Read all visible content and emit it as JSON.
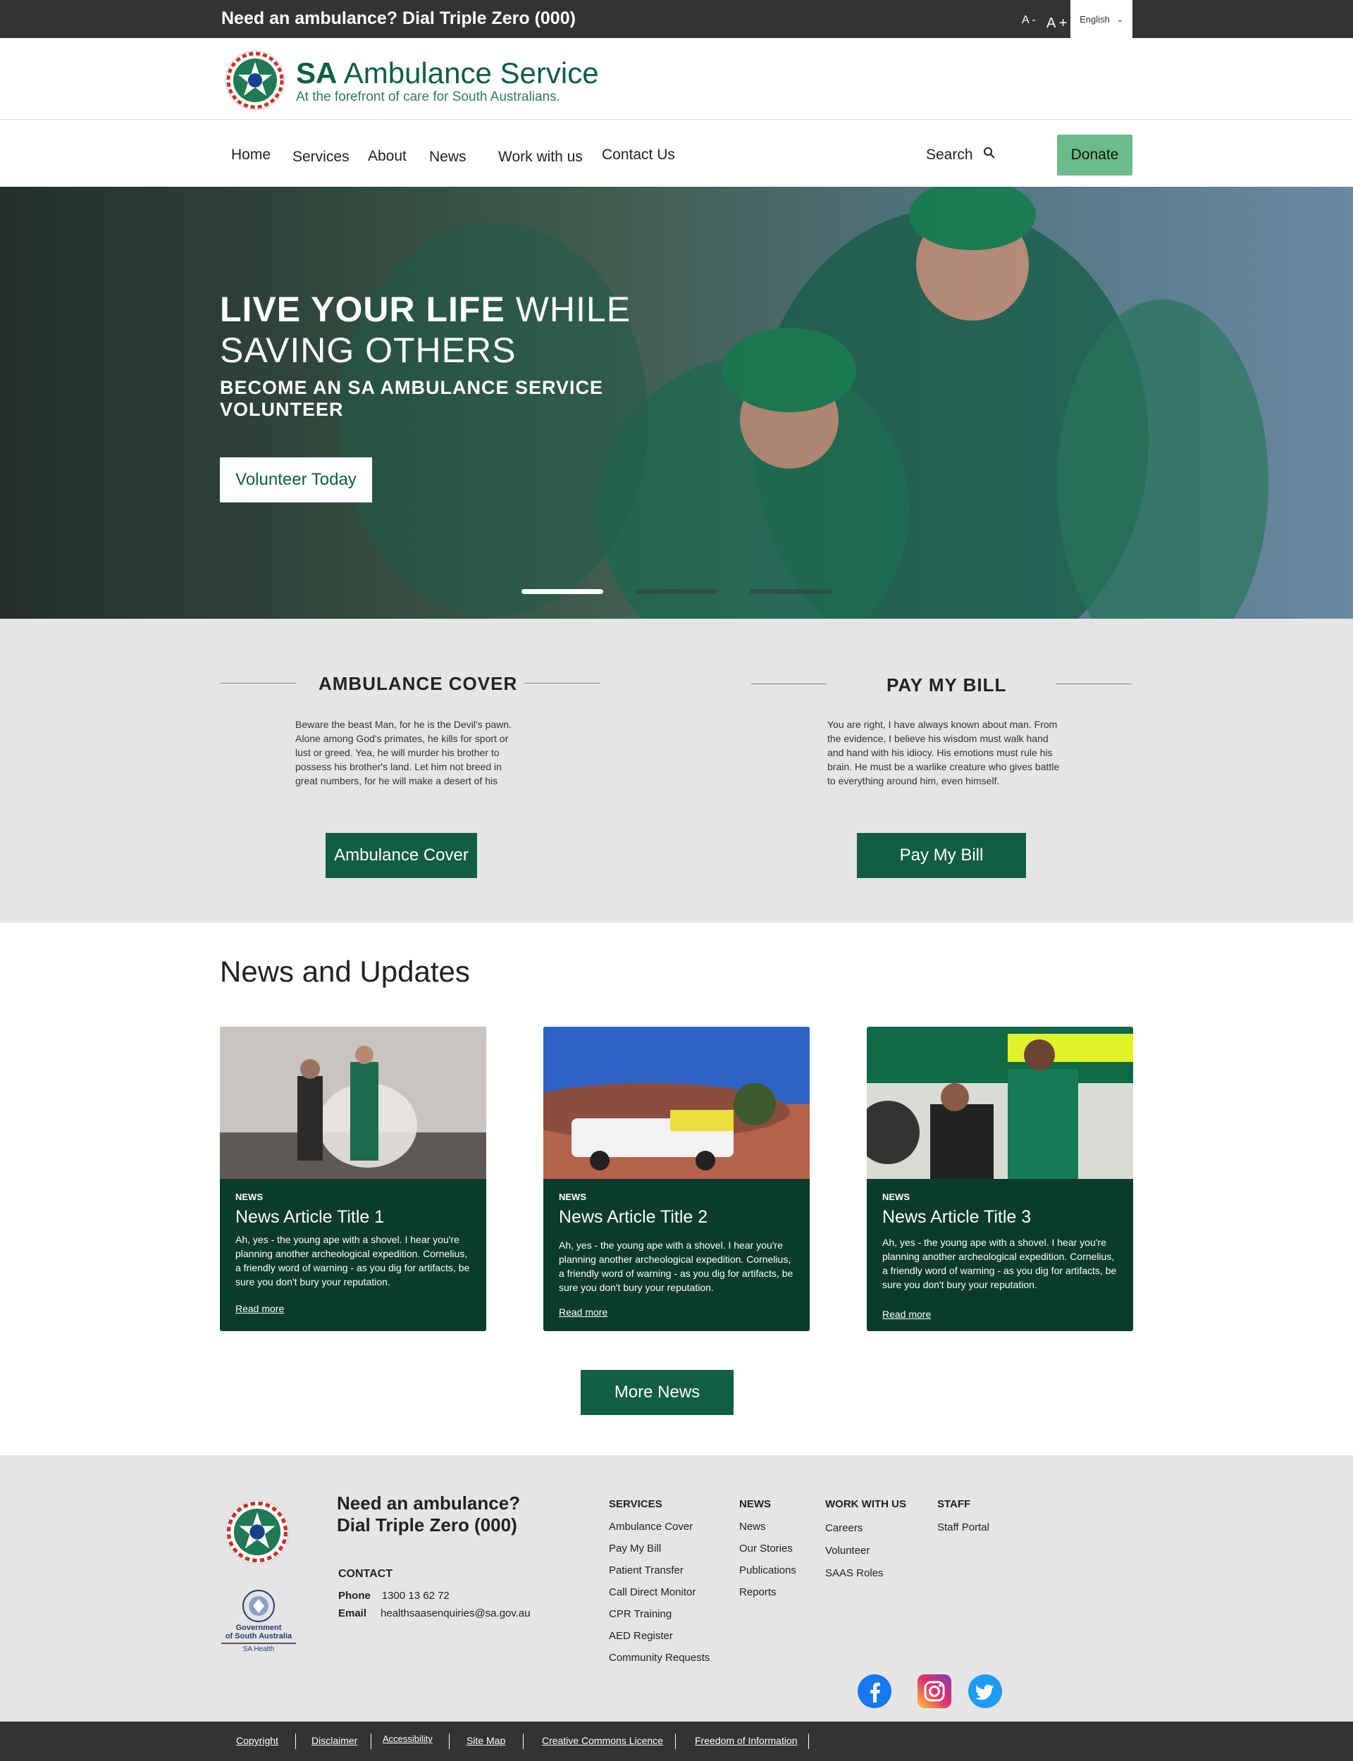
{
  "topbar": {
    "emergency": "Need an ambulance? Dial Triple Zero (000)",
    "font_decrease": "A -",
    "font_increase": "A +",
    "language": "English"
  },
  "brand": {
    "name_bold": "SA",
    "name_rest": " Ambulance Service",
    "tagline": "At the forefront of care for South Australians."
  },
  "nav": {
    "items": [
      "Home",
      "Services",
      "About",
      "News",
      "Work with us",
      "Contact Us"
    ],
    "search_label": "Search",
    "donate_label": "Donate"
  },
  "hero": {
    "headline_bold": "LIVE YOUR LIFE",
    "headline_rest": " WHILE",
    "headline_line2": "SAVING OTHERS",
    "subheadline": "BECOME AN SA AMBULANCE SERVICE VOLUNTEER",
    "cta": "Volunteer Today",
    "active_slide": 1,
    "slide_count": 3
  },
  "cover": {
    "title": "AMBULANCE COVER",
    "text": "Beware the beast Man, for he is the Devil's pawn. Alone among God's primates, he kills for sport or lust or greed. Yea, he will murder his brother to possess his brother's land. Let him not breed in great numbers, for he will make a desert of his",
    "button": "Ambulance Cover"
  },
  "bill": {
    "title": "PAY MY BILL",
    "text": "You are right, I have always known about man. From the evidence, I believe his wisdom must walk hand and hand with his idiocy. His emotions must rule his brain. He must be a warlike creature who gives battle to everything around him, even himself.",
    "button": "Pay My Bill"
  },
  "news": {
    "title": "News and Updates",
    "cards": [
      {
        "tag": "NEWS",
        "title": "News Article Title 1",
        "desc": "Ah, yes - the young ape with a shovel. I hear you're planning another archeological expedition. Cornelius, a friendly word of warning - as you dig for artifacts, be sure you don't bury your reputation.",
        "more": "Read more"
      },
      {
        "tag": "NEWS",
        "title": "News Article Title 2",
        "desc": "Ah, yes - the young ape with a shovel. I hear you're planning another archeological expedition. Cornelius, a friendly word of warning - as you dig for artifacts, be sure you don't bury your reputation.",
        "more": "Read more"
      },
      {
        "tag": "NEWS",
        "title": "News Article Title 3",
        "desc": "Ah, yes - the young ape with a shovel. I hear you're planning another archeological expedition. Cornelius, a friendly word of warning - as you dig for artifacts, be sure you don't bury your reputation.",
        "more": "Read more"
      }
    ],
    "more_button": "More News"
  },
  "footer": {
    "need_line1": "Need an ambulance?",
    "need_line2": "Dial Triple Zero (000)",
    "contact_title": "CONTACT",
    "phone_label": "Phone",
    "phone_value": "1300 13 62 72",
    "email_label": "Email",
    "email_value": "healthsaasenquiries@sa.gov.au",
    "gov_line1": "Government",
    "gov_line2": "of South Australia",
    "gov_line3": "SA Health",
    "columns": [
      {
        "title": "SERVICES",
        "items": [
          "Ambulance Cover",
          "Pay My Bill",
          "Patient Transfer",
          "Call Direct Monitor",
          "CPR Training",
          "AED Register",
          "Community Requests"
        ]
      },
      {
        "title": "NEWS",
        "items": [
          "News",
          "Our Stories",
          "Publications",
          "Reports"
        ]
      },
      {
        "title": "WORK WITH US",
        "items": [
          "Careers",
          "Volunteer",
          "SAAS Roles"
        ]
      },
      {
        "title": "STAFF",
        "items": [
          "Staff Portal"
        ]
      }
    ],
    "social": [
      "facebook-icon",
      "instagram-icon",
      "twitter-icon"
    ]
  },
  "bottom_links": [
    "Copyright",
    "Disclaimer",
    "Accessibility",
    "Site Map",
    "Creative Commons Licence",
    "Freedom of Information"
  ],
  "colors": {
    "brand_green": "#0f5e43",
    "dark_card": "#0b3b2c",
    "donate_green": "#6bbb8b",
    "topbar": "#333333",
    "band_grey": "#e5e5e5"
  }
}
